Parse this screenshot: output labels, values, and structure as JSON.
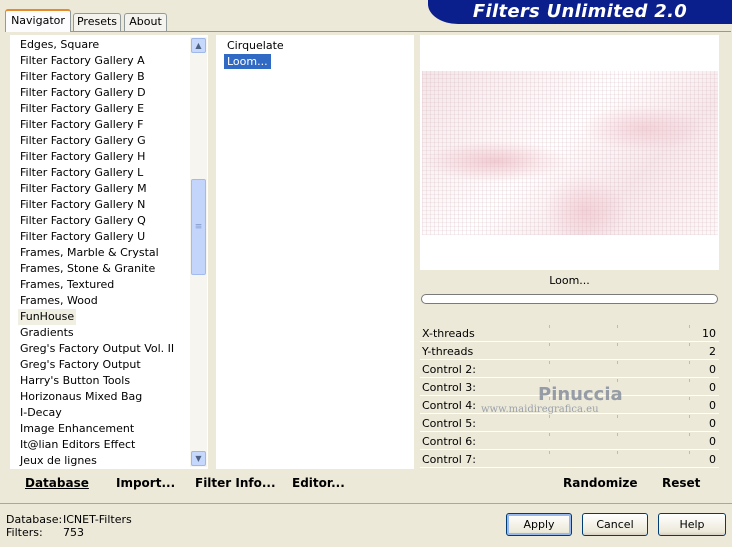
{
  "window": {
    "title": "Filters Unlimited 2.0"
  },
  "tabs": [
    {
      "label": "Navigator"
    },
    {
      "label": "Presets"
    },
    {
      "label": "About"
    }
  ],
  "categories": {
    "items": [
      "Edges, Square",
      "Filter Factory Gallery A",
      "Filter Factory Gallery B",
      "Filter Factory Gallery D",
      "Filter Factory Gallery E",
      "Filter Factory Gallery F",
      "Filter Factory Gallery G",
      "Filter Factory Gallery H",
      "Filter Factory Gallery L",
      "Filter Factory Gallery M",
      "Filter Factory Gallery N",
      "Filter Factory Gallery Q",
      "Filter Factory Gallery U",
      "Frames, Marble & Crystal",
      "Frames, Stone & Granite",
      "Frames, Textured",
      "Frames, Wood",
      "FunHouse",
      "Gradients",
      "Greg's Factory Output Vol. II",
      "Greg's Factory Output",
      "Harry's Button Tools",
      "Horizonaus Mixed Bag",
      "I-Decay",
      "Image Enhancement",
      "It@lian Editors Effect",
      "Jeux de lignes"
    ],
    "selected": "FunHouse"
  },
  "filters": {
    "items": [
      "Cirquelate",
      "Loom..."
    ],
    "selected": "Loom..."
  },
  "left_toolbar": {
    "database": "Database",
    "import": "Import...",
    "filter_info": "Filter Info...",
    "editor": "Editor..."
  },
  "preview": {
    "filter_name": "Loom...",
    "progress": 0
  },
  "controls": [
    {
      "label": "X-threads",
      "value": "10"
    },
    {
      "label": "Y-threads",
      "value": "2"
    },
    {
      "label": "Control 2:",
      "value": "0"
    },
    {
      "label": "Control 3:",
      "value": "0"
    },
    {
      "label": "Control 4:",
      "value": "0"
    },
    {
      "label": "Control 5:",
      "value": "0"
    },
    {
      "label": "Control 6:",
      "value": "0"
    },
    {
      "label": "Control 7:",
      "value": "0"
    }
  ],
  "watermark": {
    "name": "Pinuccia",
    "site": "www.maidiregrafica.eu"
  },
  "right_toolbar": {
    "randomize": "Randomize",
    "reset": "Reset"
  },
  "footer": {
    "database_label": "Database:",
    "database_value": "ICNET-Filters",
    "filters_label": "Filters:",
    "filters_value": "753"
  },
  "buttons": {
    "apply": "Apply",
    "cancel": "Cancel",
    "help": "Help"
  }
}
